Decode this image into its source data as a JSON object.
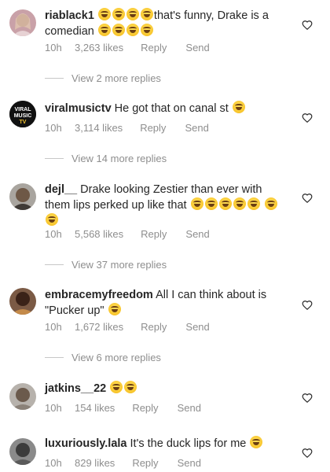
{
  "emoji_name": "face-with-tears-of-joy-emoji",
  "comments": [
    {
      "user": "riablack1",
      "text_a": "that's funny, Drake is a",
      "text_b": "comedian",
      "time": "10h",
      "likes": "3,263 likes",
      "reply": "Reply",
      "send": "Send",
      "more": "View 2 more replies"
    },
    {
      "user": "viralmusictv",
      "text": "He got that on canal st",
      "time": "10h",
      "likes": "3,114 likes",
      "reply": "Reply",
      "send": "Send",
      "more": "View 14 more replies",
      "avatar_text_1": "VIRAL",
      "avatar_text_2": "MUSIC",
      "avatar_text_3": "TV"
    },
    {
      "user": "dejl__",
      "text": "Drake looking Zestier than ever with them lips perked up like that",
      "time": "10h",
      "likes": "5,568 likes",
      "reply": "Reply",
      "send": "Send",
      "more": "View 37 more replies"
    },
    {
      "user": "embracemyfreedom",
      "text": "All I can think about is \"Pucker up\"",
      "time": "10h",
      "likes": "1,672 likes",
      "reply": "Reply",
      "send": "Send",
      "more": "View 6 more replies"
    },
    {
      "user": "jatkins__22",
      "text": "",
      "time": "10h",
      "likes": "154 likes",
      "reply": "Reply",
      "send": "Send"
    },
    {
      "user": "luxuriously.lala",
      "text": "It's the duck lips for me",
      "time": "10h",
      "likes": "829 likes",
      "reply": "Reply",
      "send": "Send"
    }
  ]
}
